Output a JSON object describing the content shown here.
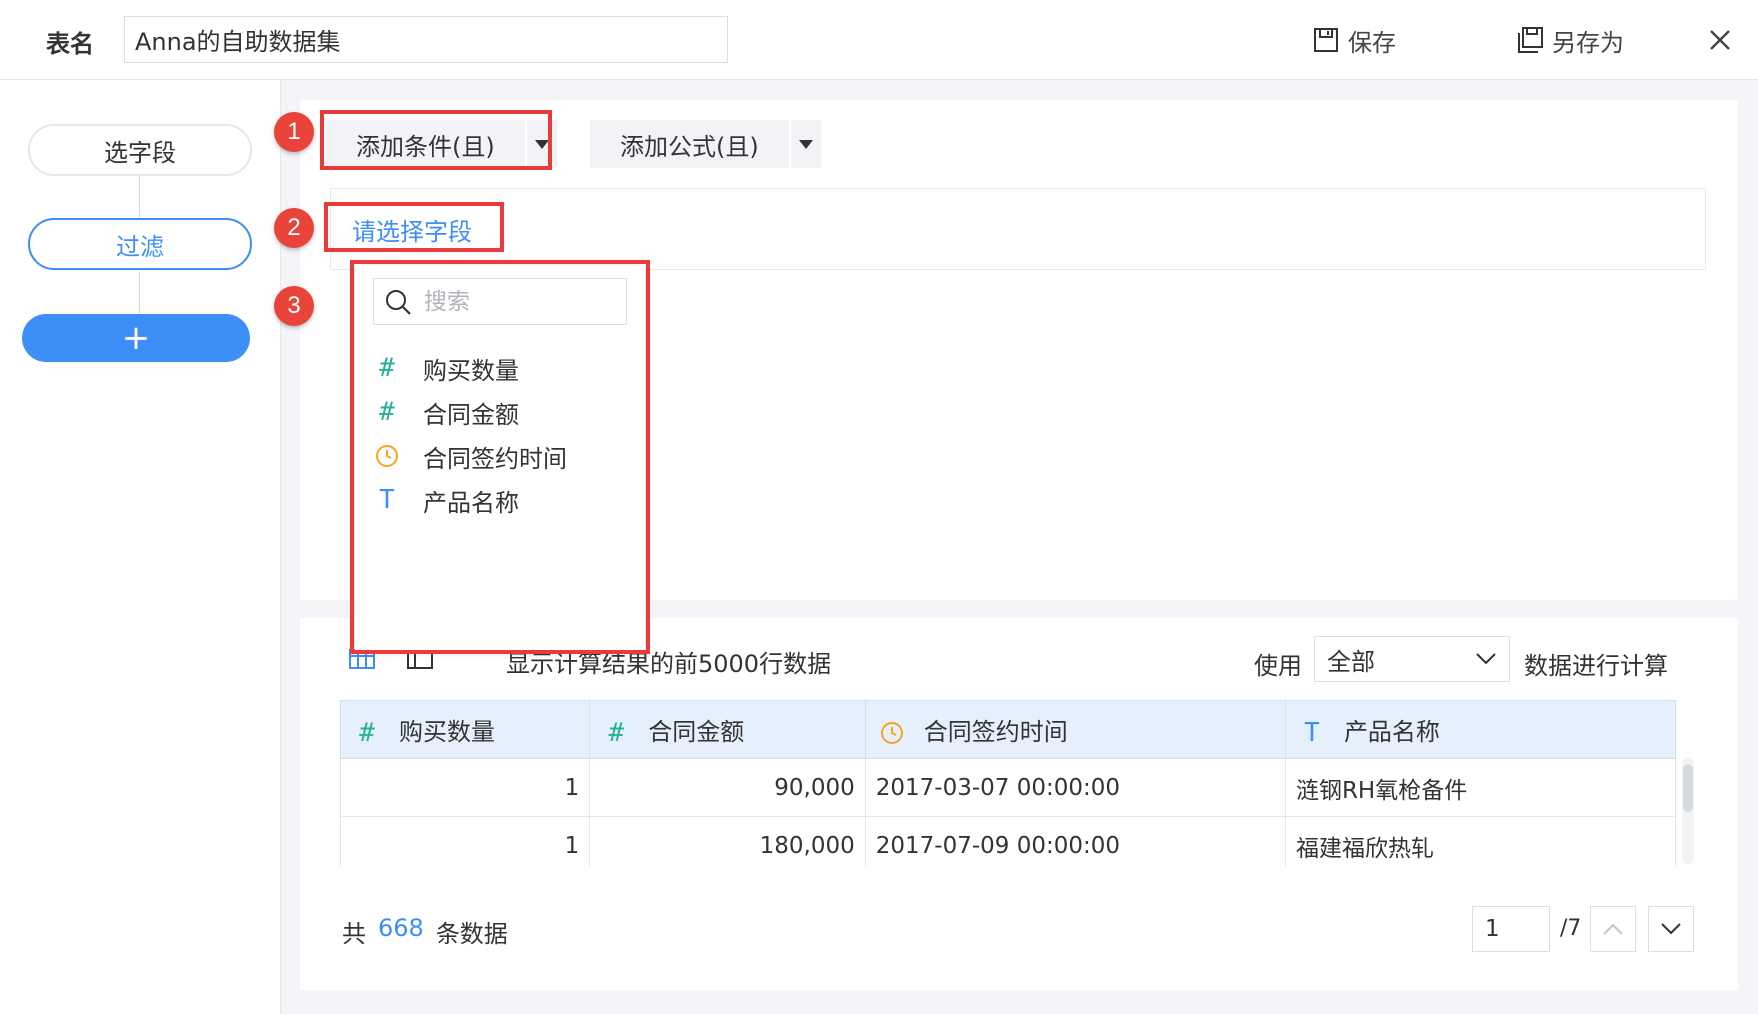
{
  "header": {
    "table_name_label": "表名",
    "table_name_value": "Anna的自助数据集",
    "save_label": "保存",
    "save_as_label": "另存为"
  },
  "steps": {
    "items": [
      {
        "label": "选字段",
        "active": false
      },
      {
        "label": "过滤",
        "active": true
      }
    ],
    "add_label": "+"
  },
  "toolbar": {
    "add_condition": "添加条件(且)",
    "add_formula": "添加公式(且)"
  },
  "condition": {
    "select_field_prompt": "请选择字段"
  },
  "annotations": [
    "1",
    "2",
    "3"
  ],
  "field_dropdown": {
    "search_placeholder": "搜索",
    "fields": [
      {
        "label": "购买数量",
        "type": "number",
        "icon": "#"
      },
      {
        "label": "合同金额",
        "type": "number",
        "icon": "#"
      },
      {
        "label": "合同签约时间",
        "type": "datetime",
        "icon": "clock-icon"
      },
      {
        "label": "产品名称",
        "type": "text",
        "icon": "T"
      }
    ]
  },
  "preview": {
    "result_text": "显示计算结果的前5000行数据",
    "use_label": "使用",
    "use_value": "全部",
    "calc_label": "数据进行计算",
    "columns": [
      {
        "label": "购买数量",
        "icon": "#"
      },
      {
        "label": "合同金额",
        "icon": "#"
      },
      {
        "label": "合同签约时间",
        "icon": "clock-icon"
      },
      {
        "label": "产品名称",
        "icon": "T"
      }
    ],
    "rows": [
      [
        "1",
        "90,000",
        "2017-03-07 00:00:00",
        "涟钢RH氧枪备件"
      ],
      [
        "1",
        "180,000",
        "2017-07-09 00:00:00",
        "福建福欣热轧"
      ]
    ]
  },
  "footer": {
    "total_prefix": "共",
    "total_count": "668",
    "total_suffix": "条数据",
    "current_page": "1",
    "page_total": "/7"
  },
  "colors": {
    "accent": "#3e8ef7",
    "annotation_red": "#e83c3c",
    "number_icon": "#25b09a",
    "date_icon": "#f5a623"
  }
}
